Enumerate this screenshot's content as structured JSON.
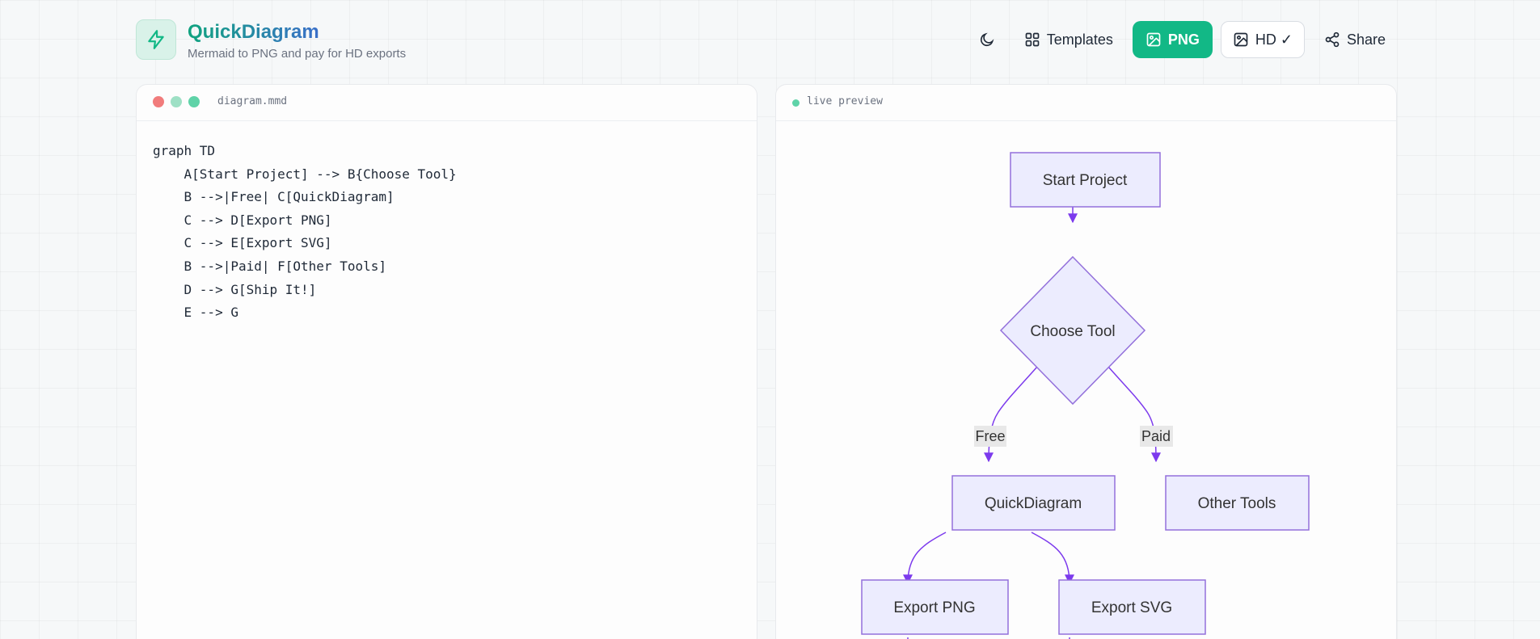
{
  "brand": {
    "title": "QuickDiagram",
    "subtitle": "Mermaid to PNG and pay for HD exports"
  },
  "nav": {
    "templates_label": "Templates",
    "png_label": "PNG",
    "hd_label": "HD ✓",
    "share_label": "Share"
  },
  "editor": {
    "filename": "diagram.mmd",
    "lines": [
      "graph TD",
      "    A[Start Project] --> B{Choose Tool}",
      "    B -->|Free| C[QuickDiagram]",
      "    C --> D[Export PNG]",
      "    C --> E[Export SVG]",
      "    B -->|Paid| F[Other Tools]",
      "    D --> G[Ship It!]",
      "    E --> G"
    ]
  },
  "preview": {
    "label": "live preview",
    "nodes": {
      "start": "Start Project",
      "choose": "Choose Tool",
      "quick": "QuickDiagram",
      "other": "Other Tools",
      "png": "Export PNG",
      "svg": "Export SVG"
    },
    "edge_labels": {
      "free": "Free",
      "paid": "Paid"
    }
  },
  "colors": {
    "accent": "#12b886",
    "node_fill": "#ececfe",
    "node_stroke": "#9370db",
    "edge": "#7c3aed",
    "dot_red": "#f17c7c",
    "dot_mint": "#9ee0c5",
    "dot_green": "#5fd3a8"
  }
}
